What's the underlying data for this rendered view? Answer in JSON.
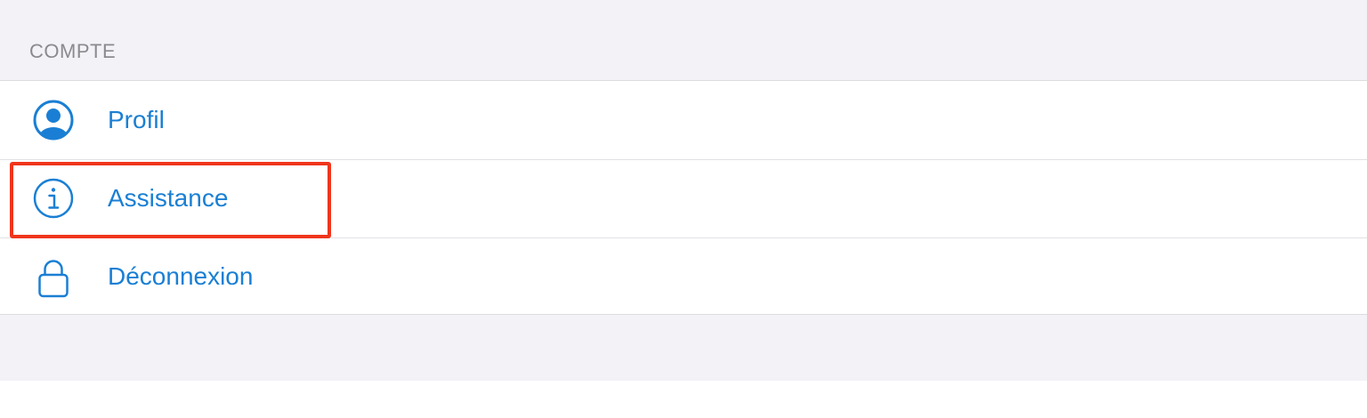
{
  "section": {
    "header": "COMPTE"
  },
  "items": [
    {
      "label": "Profil",
      "icon": "person-circle-icon"
    },
    {
      "label": "Assistance",
      "icon": "info-circle-icon"
    },
    {
      "label": "Déconnexion",
      "icon": "lock-icon"
    }
  ],
  "colors": {
    "accent": "#1a7fd4",
    "highlight": "#f0351c",
    "group_background": "#f2f2f7",
    "header_text": "#8a8a8f"
  }
}
